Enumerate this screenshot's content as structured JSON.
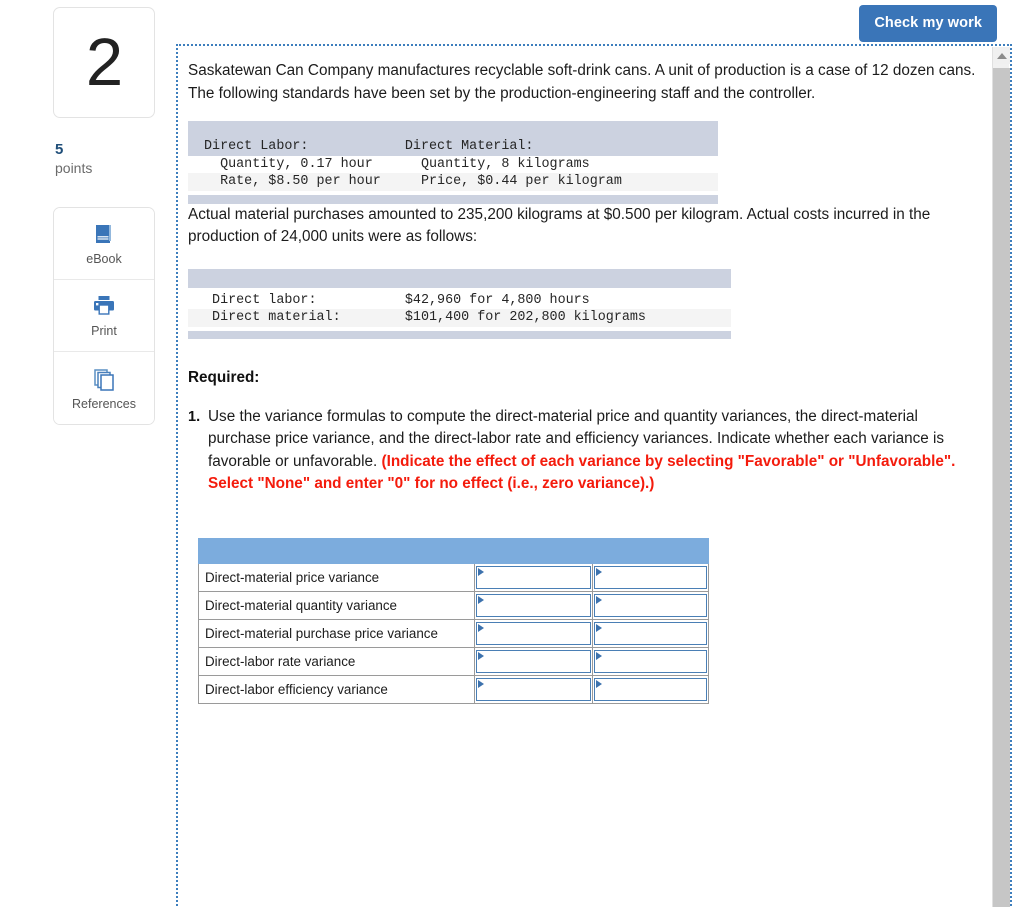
{
  "question": {
    "number": "2",
    "points_value": "5",
    "points_label": "points"
  },
  "tools": [
    {
      "label": "eBook",
      "icon": "book-icon"
    },
    {
      "label": "Print",
      "icon": "printer-icon"
    },
    {
      "label": "References",
      "icon": "references-icon"
    }
  ],
  "toolbar": {
    "check_my_work_label": "Check my work"
  },
  "content": {
    "paragraph_1": "Saskatewan Can Company manufactures recyclable soft-drink cans. A unit of production is a case of 12 dozen cans. The following standards have been set by the production-engineering staff and the controller.",
    "paragraph_2": "Actual material purchases amounted to 235,200 kilograms at $0.500 per kilogram. Actual costs incurred in the production of 24,000 units were as follows:",
    "standards_block": [
      "Direct Labor:            Direct Material:",
      "  Quantity, 0.17 hour      Quantity, 8 kilograms",
      "  Rate, $8.50 per hour     Price, $0.44 per kilogram"
    ],
    "actual_costs_block": [
      " Direct labor:           $42,960 for 4,800 hours",
      " Direct material:        $101,400 for 202,800 kilograms"
    ],
    "required_heading": "Required:",
    "requirement_1_plain": "Use the variance formulas to compute the direct-material price and quantity variances, the direct-material purchase price variance, and the direct-labor rate and efficiency variances. Indicate whether each variance is favorable or unfavorable. ",
    "requirement_1_emphasis": "(Indicate the effect of each variance by selecting \"Favorable\" or \"Unfavorable\". Select \"None\" and enter \"0\" for no effect (i.e., zero variance).)",
    "requirement_1_marker": "1."
  },
  "answer_table": {
    "headers": [
      "",
      "",
      ""
    ],
    "rows": [
      {
        "label": "Direct-material price variance",
        "value_1": "",
        "value_2": ""
      },
      {
        "label": "Direct-material quantity variance",
        "value_1": "",
        "value_2": ""
      },
      {
        "label": "Direct-material purchase price variance",
        "value_1": "",
        "value_2": ""
      },
      {
        "label": "Direct-labor rate variance",
        "value_1": "",
        "value_2": ""
      },
      {
        "label": "Direct-labor efficiency variance",
        "value_1": "",
        "value_2": ""
      }
    ]
  },
  "colors": {
    "accent_blue": "#3a75b8",
    "table_header_blue": "#7cacdd",
    "band_blue_gray": "#ccd2e0",
    "emphasis_red": "#f41b0c",
    "points_blue": "#1f4e79"
  }
}
